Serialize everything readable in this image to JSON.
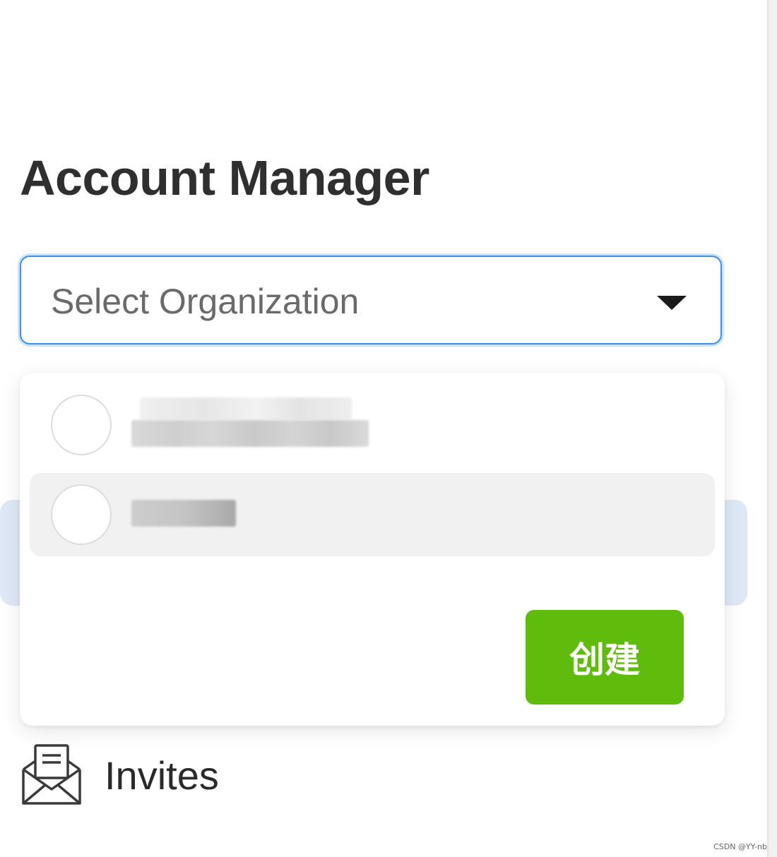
{
  "page": {
    "title": "Account Manager"
  },
  "org_select": {
    "placeholder": "Select Organization",
    "accent_color": "#3c8ef3",
    "caret_icon": "caret-down-icon"
  },
  "dropdown": {
    "items": [
      {
        "avatar_icon": "empty-circle-avatar",
        "name_redacted": true,
        "highlighted": false
      },
      {
        "avatar_icon": "empty-circle-avatar",
        "name_redacted": true,
        "highlighted": true
      }
    ],
    "create_button_label": "创建",
    "create_button_color": "#5fbc0d"
  },
  "nav": {
    "invites_label": "Invites",
    "invites_icon": "envelope-open-icon"
  },
  "watermark": "CSDN @YY-nb"
}
